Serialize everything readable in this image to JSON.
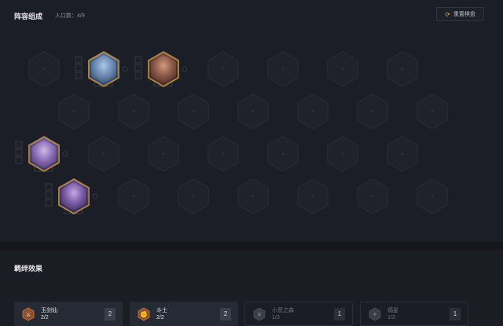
{
  "header": {
    "title": "阵容组成",
    "population": "人口数：4/9",
    "reset_label": "重置棋盘"
  },
  "board": {
    "rows": 4,
    "cols": 7,
    "units": [
      {
        "name": "champion-1",
        "row": 0,
        "col": 1,
        "stars": 1,
        "border": "#b78a3c",
        "colors": [
          "#6c8ab3",
          "#2b3d55",
          "#a9c7e6"
        ]
      },
      {
        "name": "champion-2",
        "row": 0,
        "col": 2,
        "stars": 1,
        "border": "#b78a3c",
        "colors": [
          "#8c5a4a",
          "#3d2622",
          "#d29a7c"
        ]
      },
      {
        "name": "champion-3",
        "row": 2,
        "col": 0,
        "stars": 1,
        "border": "#b78a3c",
        "colors": [
          "#8a6fb7",
          "#3b2d55",
          "#d2b7e6"
        ]
      },
      {
        "name": "champion-4",
        "row": 3,
        "col": 0,
        "stars": 1,
        "border": "#b78a3c",
        "colors": [
          "#7a5ca8",
          "#2d2440",
          "#c9a7e6"
        ]
      }
    ]
  },
  "bonds": {
    "title": "羁绊效果",
    "traits": [
      {
        "name": "玉剑仙",
        "count": "2/2",
        "num": "2",
        "active": true,
        "icon": "jade-sword-icon",
        "icon_color": "#8c4f2c"
      },
      {
        "name": "斗士",
        "count": "2/2",
        "num": "2",
        "active": true,
        "icon": "brawler-icon",
        "icon_color": "#8c4f2c"
      },
      {
        "name": "小恶之森",
        "count": "1/3",
        "num": "1",
        "active": false,
        "icon": "forest-icon",
        "icon_color": "#3a3e48"
      },
      {
        "name": "福星",
        "count": "1/3",
        "num": "1",
        "active": false,
        "icon": "fortune-icon",
        "icon_color": "#3a3e48"
      }
    ]
  }
}
